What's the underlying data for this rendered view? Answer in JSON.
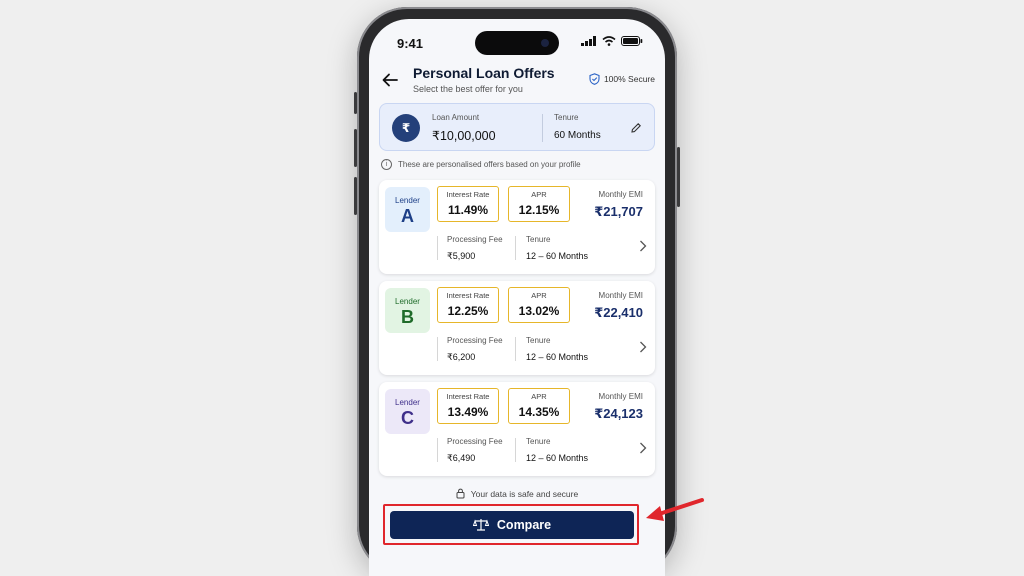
{
  "status_bar": {
    "time": "9:41"
  },
  "header": {
    "title": "Personal Loan Offers",
    "subtitle": "Select the best offer for you",
    "secure_label": "100% Secure"
  },
  "summary": {
    "amount_label": "Loan Amount",
    "amount_value": "₹10,00,000",
    "tenure_label": "Tenure",
    "tenure_value": "60 Months",
    "icon_glyph": "₹"
  },
  "notice": "These are personalised offers based on your profile",
  "offers": [
    {
      "lender_label": "Lender",
      "lender_code": "A",
      "interest_label": "Interest Rate",
      "interest_value": "11.49%",
      "apr_label": "APR",
      "apr_value": "12.15%",
      "emi_label": "Monthly EMI",
      "emi_value": "₹21,707",
      "fee_label": "Processing Fee",
      "fee_value": "₹5,900",
      "tenure_label": "Tenure",
      "tenure_value": "12 – 60 Months",
      "badge_bg": "#e3effc",
      "badge_fg": "#1d3f87"
    },
    {
      "lender_label": "Lender",
      "lender_code": "B",
      "interest_label": "Interest Rate",
      "interest_value": "12.25%",
      "apr_label": "APR",
      "apr_value": "13.02%",
      "emi_label": "Monthly EMI",
      "emi_value": "₹22,410",
      "fee_label": "Processing Fee",
      "fee_value": "₹6,200",
      "tenure_label": "Tenure",
      "tenure_value": "12 – 60 Months",
      "badge_bg": "#e2f4e3",
      "badge_fg": "#1f6b2a"
    },
    {
      "lender_label": "Lender",
      "lender_code": "C",
      "interest_label": "Interest Rate",
      "interest_value": "13.49%",
      "apr_label": "APR",
      "apr_value": "14.35%",
      "emi_label": "Monthly EMI",
      "emi_value": "₹24,123",
      "fee_label": "Processing Fee",
      "fee_value": "₹6,490",
      "tenure_label": "Tenure",
      "tenure_value": "12 – 60 Months",
      "badge_bg": "#ece8f8",
      "badge_fg": "#3f2f8a"
    }
  ],
  "safe_note": "Your data is safe and secure",
  "compare_label": "Compare",
  "colors": {
    "primary": "#0e2556",
    "highlight_border": "#e0262c",
    "metric_border": "#e6b62a",
    "emi_text": "#1a2f6b"
  }
}
